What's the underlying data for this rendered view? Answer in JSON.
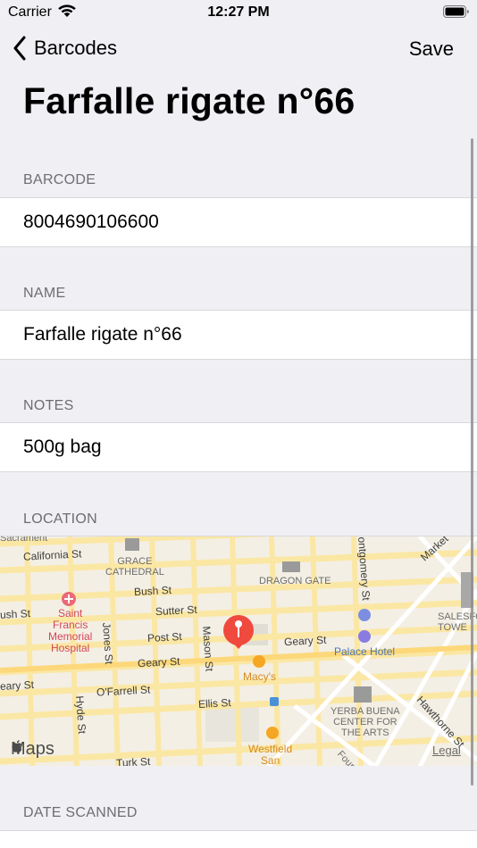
{
  "status_bar": {
    "carrier": "Carrier",
    "time": "12:27 PM"
  },
  "nav": {
    "back_label": "Barcodes",
    "save_label": "Save"
  },
  "page": {
    "title": "Farfalle rigate n°66"
  },
  "sections": {
    "barcode": {
      "header": "BARCODE",
      "value": "8004690106600"
    },
    "name": {
      "header": "NAME",
      "value": "Farfalle rigate n°66"
    },
    "notes": {
      "header": "NOTES",
      "value": "500g bag"
    },
    "location": {
      "header": "LOCATION"
    },
    "date_scanned": {
      "header": "DATE SCANNED"
    }
  },
  "map": {
    "streets": {
      "sacramento": "Sacrament",
      "california": "California St",
      "bush": "Bush St",
      "bush_left": "ush St",
      "sutter": "Sutter St",
      "post": "Post St",
      "geary_mid": "Geary St",
      "geary_right": "Geary St",
      "geary_left": "eary St",
      "ofarrell": "O'Farrell St",
      "ellis": "Ellis St",
      "turk": "Turk St",
      "jones": "Jones St",
      "mason": "Mason St",
      "hyde": "Hyde St",
      "montgomery": "ontgomery St",
      "market": "Market",
      "hawthorne": "Hawthorne St",
      "fourth": "Fourth"
    },
    "places": {
      "grace_cathedral": "GRACE\nCATHEDRAL",
      "dragon_gate": "DRAGON GATE",
      "saint_francis": "Saint\nFrancis\nMemorial\nHospital",
      "palace_hotel": "Palace Hotel",
      "macys": "Macy's",
      "yerba_buena": "YERBA BUENA\nCENTER FOR\nTHE ARTS",
      "westfield": "Westfield\nSan",
      "salesforce": "SALESFO\nTOWE"
    },
    "logo": "Maps",
    "legal": "Legal"
  },
  "colors": {
    "background": "#efeff4",
    "accent": "#000000",
    "section_header": "#6d6d72",
    "pin": "#f0493d",
    "map_land": "#f3efe4",
    "map_road": "#fbe7a4"
  }
}
